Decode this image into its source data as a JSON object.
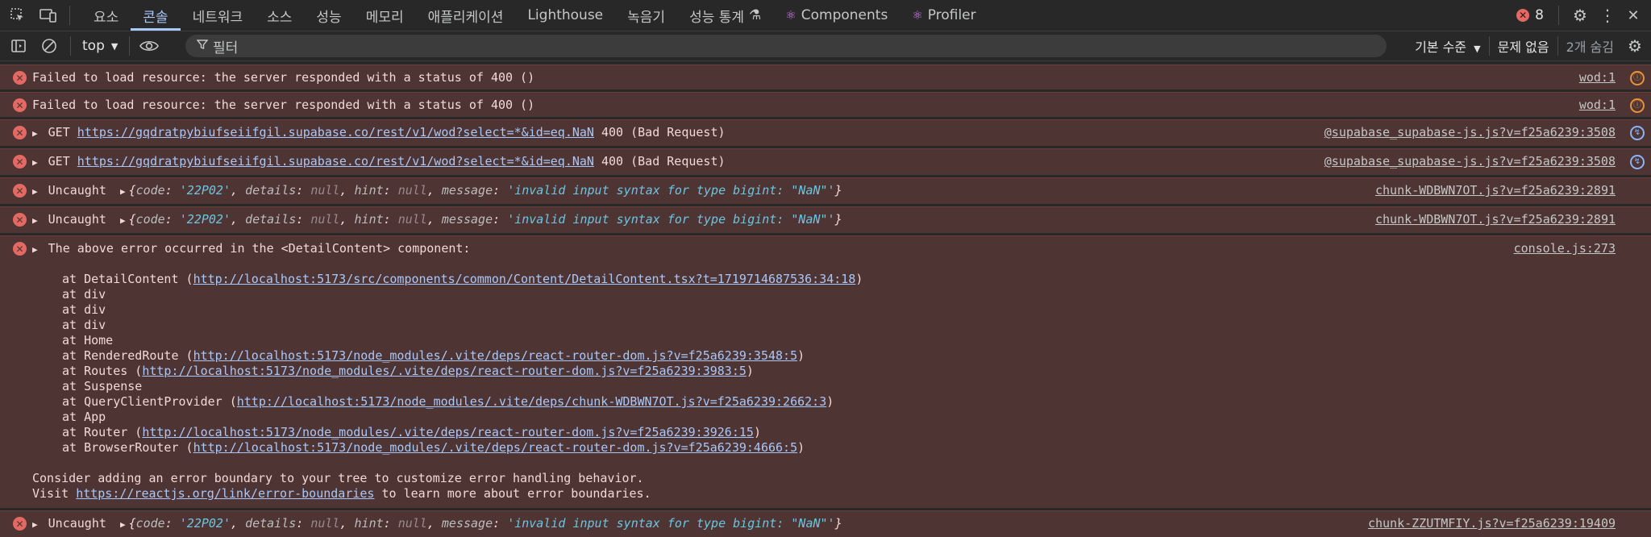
{
  "tabs": [
    "요소",
    "콘솔",
    "네트워크",
    "소스",
    "성능",
    "메모리",
    "애플리케이션",
    "Lighthouse",
    "녹음기",
    "성능 통계",
    "Components",
    "Profiler"
  ],
  "active_tab": "콘솔",
  "error_count": "8",
  "toolbar": {
    "context": "top",
    "filter_placeholder": "필터",
    "level": "기본 수준",
    "issues": "문제 없음",
    "hidden": "2개 숨김"
  },
  "messages": [
    {
      "text": "Failed to load resource: the server responded with a status of 400 ()",
      "source": "wod:1"
    },
    {
      "text": "Failed to load resource: the server responded with a status of 400 ()",
      "source": "wod:1"
    },
    {
      "method": "GET",
      "url": "https://gqdratpybiufseiifgil.supabase.co/rest/v1/wod?select=*&id=eq.NaN",
      "status": "400 (Bad Request)",
      "source": "@supabase_supabase-js.js?v=f25a6239:3508"
    },
    {
      "method": "GET",
      "url": "https://gqdratpybiufseiifgil.supabase.co/rest/v1/wod?select=*&id=eq.NaN",
      "status": "400 (Bad Request)",
      "source": "@supabase_supabase-js.js?v=f25a6239:3508"
    },
    {
      "prefix": "Uncaught",
      "code": "'22P02'",
      "message": "'invalid input syntax for type bigint: \"NaN\"'",
      "source": "chunk-WDBWN7OT.js?v=f25a6239:2891"
    },
    {
      "prefix": "Uncaught",
      "code": "'22P02'",
      "message": "'invalid input syntax for type bigint: \"NaN\"'",
      "source": "chunk-WDBWN7OT.js?v=f25a6239:2891"
    },
    {
      "text": "The above error occurred in the <DetailContent> component:",
      "source": "console.js:273",
      "stack": [
        {
          "fn": "DetailContent",
          "url": "http://localhost:5173/src/components/common/Content/DetailContent.tsx?t=1719714687536:34:18"
        },
        {
          "fn": "div"
        },
        {
          "fn": "div"
        },
        {
          "fn": "div"
        },
        {
          "fn": "Home"
        },
        {
          "fn": "RenderedRoute",
          "url": "http://localhost:5173/node_modules/.vite/deps/react-router-dom.js?v=f25a6239:3548:5"
        },
        {
          "fn": "Routes",
          "url": "http://localhost:5173/node_modules/.vite/deps/react-router-dom.js?v=f25a6239:3983:5"
        },
        {
          "fn": "Suspense"
        },
        {
          "fn": "QueryClientProvider",
          "url": "http://localhost:5173/node_modules/.vite/deps/chunk-WDBWN7OT.js?v=f25a6239:2662:3"
        },
        {
          "fn": "App"
        },
        {
          "fn": "Router",
          "url": "http://localhost:5173/node_modules/.vite/deps/react-router-dom.js?v=f25a6239:3926:15"
        },
        {
          "fn": "BrowserRouter",
          "url": "http://localhost:5173/node_modules/.vite/deps/react-router-dom.js?v=f25a6239:4666:5"
        }
      ],
      "advice": "Consider adding an error boundary to your tree to customize error handling behavior.",
      "visit_prefix": "Visit ",
      "visit_url": "https://reactjs.org/link/error-boundaries",
      "visit_suffix": " to learn more about error boundaries."
    },
    {
      "prefix": "Uncaught",
      "code": "'22P02'",
      "message": "'invalid input syntax for type bigint: \"NaN\"'",
      "source": "chunk-ZZUTMFIY.js?v=f25a6239:19409"
    }
  ]
}
